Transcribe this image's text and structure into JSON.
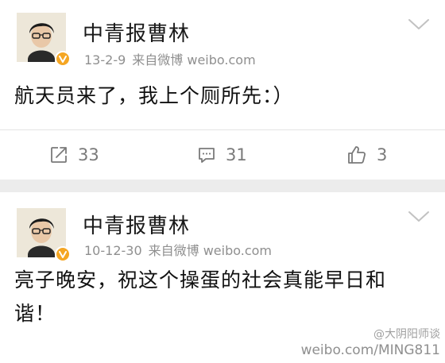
{
  "posts": [
    {
      "username": "中青报曹林",
      "date": "13-2-9",
      "source": "来自微博 weibo.com",
      "text": "航天员来了，我上个厕所先：）",
      "actions": {
        "repost_count": "33",
        "comment_count": "31",
        "like_count": "3"
      }
    },
    {
      "username": "中青报曹林",
      "date": "10-12-30",
      "source": "来自微博 weibo.com",
      "text": "亮子晚安，祝这个操蛋的社会真能早日和谐！"
    }
  ],
  "watermark": {
    "handle": "@大阴阳师谈",
    "site": "weibo.com/MING811"
  },
  "icons": {
    "repost": "repost-icon",
    "comment": "comment-icon",
    "like": "thumbs-up-icon",
    "dropdown": "chevron-down-icon",
    "verified": "verified-badge-icon"
  },
  "colors": {
    "verified_badge": "#f5a623",
    "meta_text": "#8f8f8f",
    "action_text": "#7a7a7a",
    "feed_background": "#ececec"
  }
}
